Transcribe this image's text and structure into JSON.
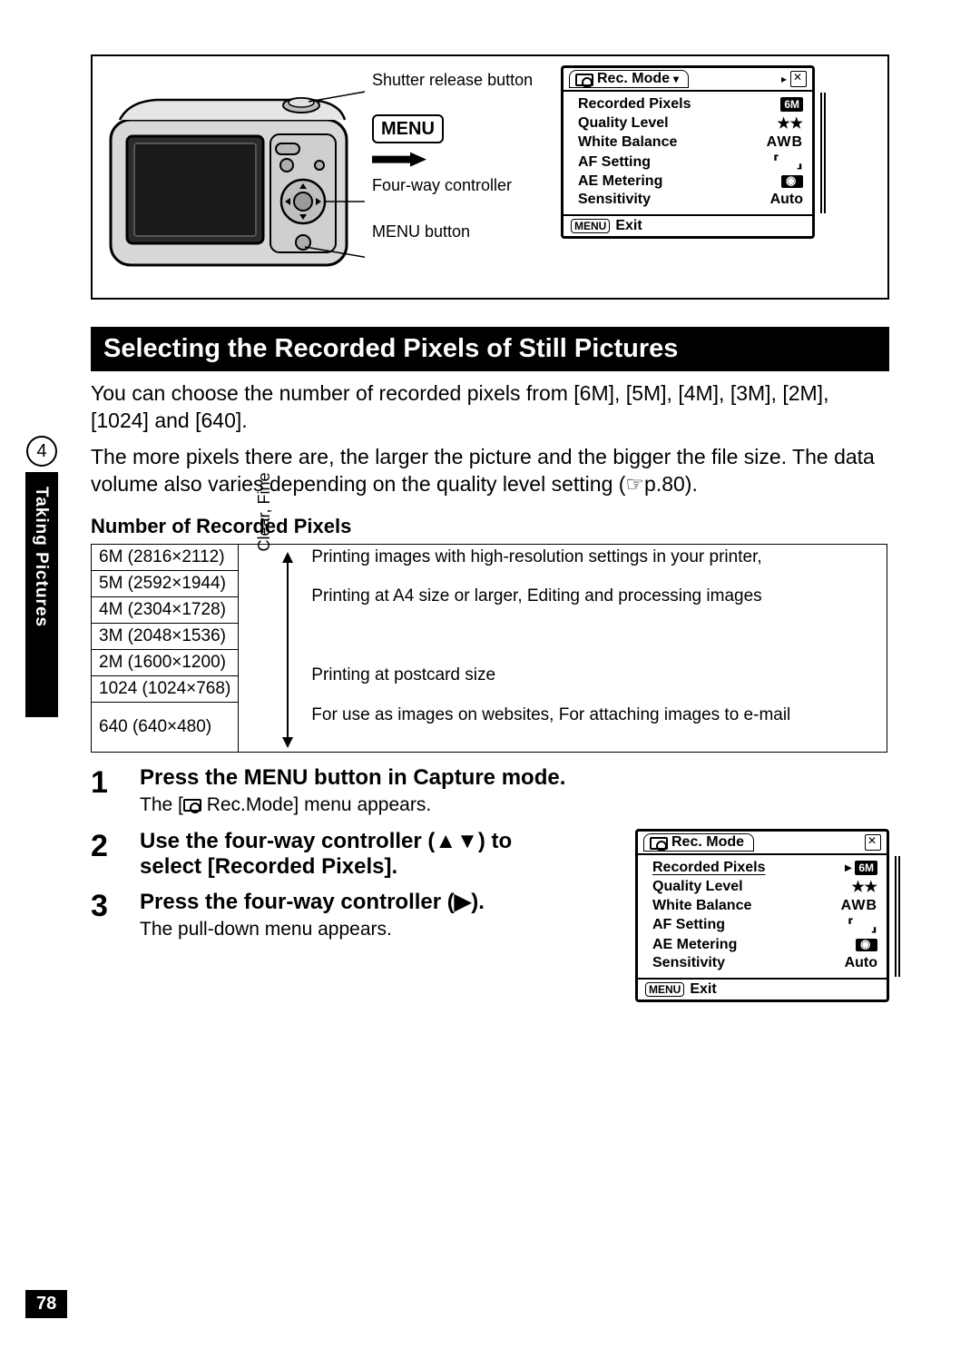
{
  "diagram": {
    "label_shutter": "Shutter release button",
    "label_fourway": "Four-way controller",
    "label_menubtn": "MENU button",
    "menu_badge": "MENU"
  },
  "menu1": {
    "tab_title": "Rec. Mode",
    "rows": [
      {
        "label": "Recorded Pixels",
        "value_badge": "6M"
      },
      {
        "label": "Quality Level",
        "value": "★★"
      },
      {
        "label": "White Balance",
        "value": "AWB"
      },
      {
        "label": "AF Setting",
        "value": "[  ]"
      },
      {
        "label": "AE Metering",
        "value_icon": "metering"
      },
      {
        "label": "Sensitivity",
        "value": "Auto"
      }
    ],
    "footer_btn": "MENU",
    "footer_text": "Exit"
  },
  "heading": "Selecting the Recorded Pixels of Still Pictures",
  "para1": "You can choose the number of recorded pixels from [6M], [5M], [4M], [3M], [2M], [1024] and [640].",
  "para2": "The more pixels there are, the larger the picture and the bigger the file size. The data volume also varies depending on the quality level setting (☞p.80).",
  "subheading": "Number of Recorded Pixels",
  "pixel_table": {
    "sizes": [
      "6M (2816×2112)",
      "5M (2592×1944)",
      "4M (2304×1728)",
      "3M (2048×1536)",
      "2M (1600×1200)",
      "1024 (1024×768)",
      "640 (640×480)"
    ],
    "arrow_label": "Clear, Fine",
    "desc_top1": "Printing images with high-resolution settings in your printer,",
    "desc_top2": "Printing at A4 size or larger, Editing and processing images",
    "desc_mid": "Printing at postcard size",
    "desc_bot": "For use as images on websites, For attaching images to e-mail"
  },
  "steps": [
    {
      "num": "1",
      "title": "Press the MENU button in Capture mode.",
      "sub": "The [📷 Rec.Mode] menu appears."
    },
    {
      "num": "2",
      "title": "Use the four-way controller (▲▼) to select [Recorded Pixels]."
    },
    {
      "num": "3",
      "title": "Press the four-way controller (▶).",
      "sub": "The pull-down menu appears."
    }
  ],
  "menu2": {
    "tab_title": "Rec. Mode",
    "rows": [
      {
        "label": "Recorded Pixels",
        "value_badge": "6M",
        "selected": true
      },
      {
        "label": "Quality Level",
        "value": "★★"
      },
      {
        "label": "White Balance",
        "value": "AWB"
      },
      {
        "label": "AF Setting",
        "value": "[  ]"
      },
      {
        "label": "AE Metering",
        "value_icon": "metering"
      },
      {
        "label": "Sensitivity",
        "value": "Auto"
      }
    ],
    "footer_btn": "MENU",
    "footer_text": "Exit"
  },
  "side": {
    "chapter": "4",
    "label": "Taking Pictures"
  },
  "page_number": "78"
}
